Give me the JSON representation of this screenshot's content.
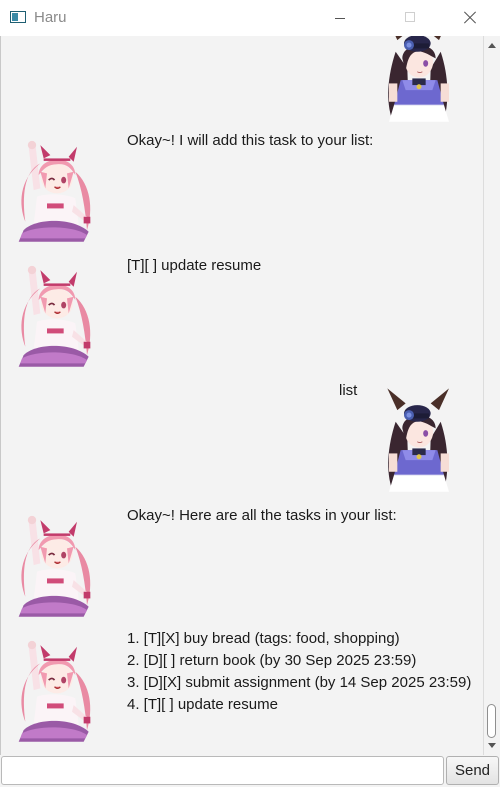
{
  "window": {
    "title": "Haru"
  },
  "messages": [
    {
      "from": "user",
      "text": "",
      "avatar": "user-avatar"
    },
    {
      "from": "bot",
      "text": "Okay~! I will add this task to your list:",
      "avatar": "bot-avatar"
    },
    {
      "from": "bot",
      "text": "[T][ ] update resume",
      "avatar": "bot-avatar"
    },
    {
      "from": "user",
      "text": "list",
      "avatar": "user-avatar"
    },
    {
      "from": "bot",
      "text": "Okay~! Here are all the tasks in your list:",
      "avatar": "bot-avatar"
    },
    {
      "from": "bot",
      "lines": [
        "1. [T][X] buy bread (tags: food, shopping)",
        "2. [D][ ] return book (by 30 Sep 2025 23:59)",
        "3. [D][X] submit assignment (by 14 Sep 2025 23:59)",
        "4. [T][ ] update resume"
      ],
      "avatar": "bot-avatar"
    }
  ],
  "input": {
    "value": "",
    "placeholder": ""
  },
  "send_label": "Send",
  "colors": {
    "chat_bg": "#f3f3f3",
    "bot_hair": "#f19ab0",
    "user_hat": "#28264a",
    "user_dress": "#6d68cf"
  }
}
